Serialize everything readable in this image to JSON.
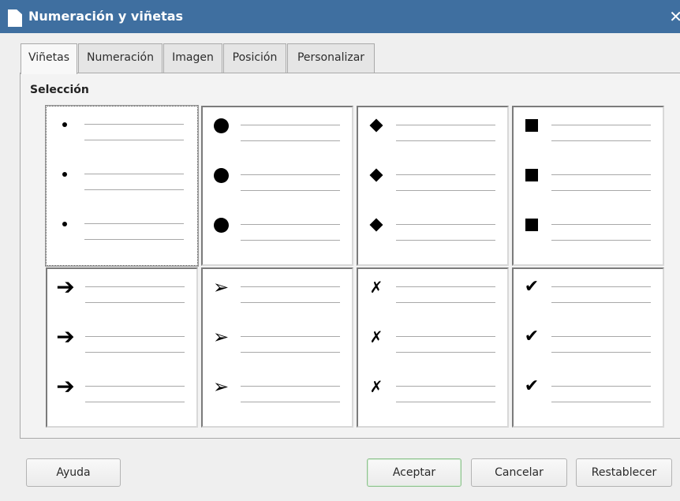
{
  "window": {
    "title": "Numeración y viñetas",
    "close_glyph": "✕"
  },
  "tabs": [
    {
      "label": "Viñetas",
      "active": true
    },
    {
      "label": "Numeración",
      "active": false
    },
    {
      "label": "Imagen",
      "active": false
    },
    {
      "label": "Posición",
      "active": false
    },
    {
      "label": "Personalizar",
      "active": false
    }
  ],
  "selection": {
    "label": "Selección",
    "selected_index": 0,
    "styles": [
      {
        "icon": "small-dot-bullet-icon"
      },
      {
        "icon": "large-circle-bullet-icon"
      },
      {
        "icon": "diamond-bullet-icon"
      },
      {
        "icon": "square-bullet-icon"
      },
      {
        "icon": "bold-arrow-bullet-icon",
        "glyph": "➔"
      },
      {
        "icon": "arrowhead-bullet-icon",
        "glyph": "➢"
      },
      {
        "icon": "cross-mark-bullet-icon",
        "glyph": "✗"
      },
      {
        "icon": "check-mark-bullet-icon",
        "glyph": "✔"
      }
    ]
  },
  "buttons": {
    "help": "Ayuda",
    "ok": "Aceptar",
    "cancel": "Cancelar",
    "reset": "Restablecer"
  }
}
